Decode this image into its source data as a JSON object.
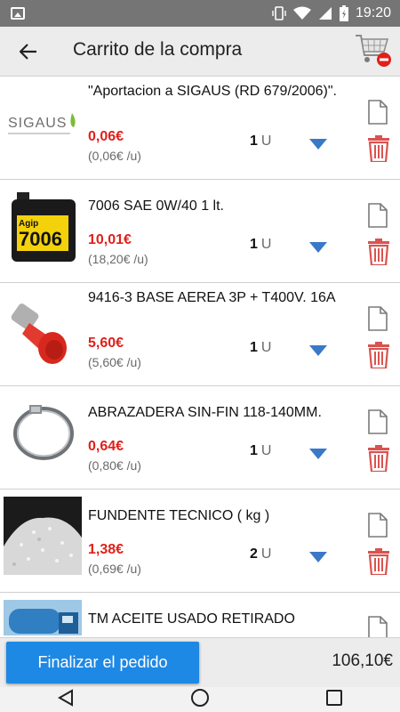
{
  "status_bar": {
    "time": "19:20",
    "icons": [
      "gallery-icon",
      "vibrate-icon",
      "wifi-icon",
      "signal-icon",
      "battery-icon"
    ]
  },
  "app_bar": {
    "title": "Carrito de la compra",
    "back_icon": "arrow-left-icon",
    "cart_icon": "cart-remove-icon"
  },
  "items": [
    {
      "name": "\"Aportacion a SIGAUS (RD 679/2006)\".",
      "price": "0,06€",
      "unit_price": "(0,06€ /u)",
      "quantity": "1",
      "unit": "U",
      "thumb": "SIGAUS"
    },
    {
      "name": "7006 SAE 0W/40 1 lt.",
      "price": "10,01€",
      "unit_price": "(18,20€ /u)",
      "quantity": "1",
      "unit": "U",
      "thumb": "7006"
    },
    {
      "name": "9416-3 BASE AEREA 3P + T400V. 16A",
      "price": "5,60€",
      "unit_price": "(5,60€ /u)",
      "quantity": "1",
      "unit": "U",
      "thumb": ""
    },
    {
      "name": "ABRAZADERA SIN-FIN 118-140MM.",
      "price": "0,64€",
      "unit_price": "(0,80€ /u)",
      "quantity": "1",
      "unit": "U",
      "thumb": ""
    },
    {
      "name": "FUNDENTE TECNICO ( kg )",
      "price": "1,38€",
      "unit_price": "(0,69€ /u)",
      "quantity": "2",
      "unit": "U",
      "thumb": ""
    },
    {
      "name": "TM ACEITE USADO RETIRADO",
      "price": "",
      "unit_price": "",
      "quantity": "",
      "unit": "",
      "thumb": ""
    }
  ],
  "footer": {
    "finish_label": "Finalizar el pedido",
    "total": "106,10€"
  },
  "colors": {
    "accent": "#1e88e5",
    "price": "#e0201a",
    "trash": "#d9534f",
    "dropdown": "#3a78c8"
  }
}
